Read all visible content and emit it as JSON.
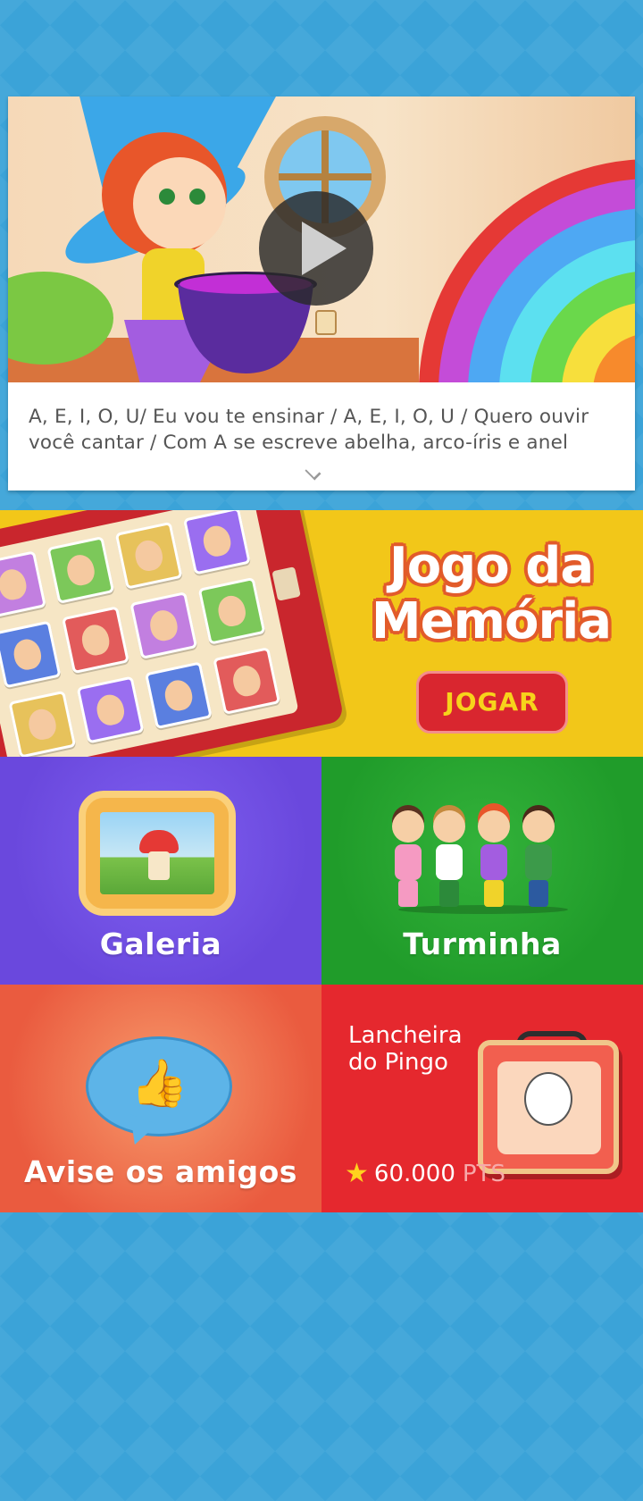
{
  "video": {
    "lyrics_line1": "A, E, I, O, U/ Eu vou te ensinar / A, E, I, O, U / Quero ouvir",
    "lyrics_line2": "você cantar / Com A se escreve abelha, arco-íris e anel",
    "play_icon": "play-icon",
    "expand_icon": "chevron-down-icon"
  },
  "memory_game": {
    "title_line1": "Jogo da",
    "title_line2": "Memória",
    "play_label": "JOGAR"
  },
  "tiles": {
    "galeria_label": "Galeria",
    "turminha_label": "Turminha",
    "avise_label": "Avise os amigos",
    "lancheira_title_line1": "Lancheira",
    "lancheira_title_line2": "do Pingo",
    "lancheira_points": "60.000",
    "lancheira_points_unit": "PTS"
  },
  "colors": {
    "background": "#3ba3d8",
    "memory_banner": "#f2c719",
    "galeria": "#6a48dd",
    "turminha": "#209c2a",
    "avise": "#ea5b3f",
    "lancheira": "#e5282e",
    "play_button": "#d9262f"
  }
}
